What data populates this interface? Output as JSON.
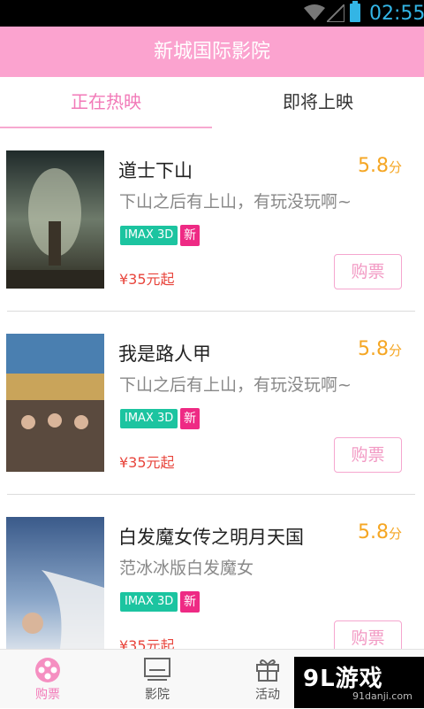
{
  "status_bar": {
    "time": "02:55",
    "accent_color": "#33b5e5",
    "icons": [
      "wifi-icon",
      "signal-icon",
      "battery-icon"
    ]
  },
  "header": {
    "title": "新城国际影院",
    "background_color": "#fba3cf"
  },
  "tabs": [
    {
      "label": "正在热映",
      "active": true
    },
    {
      "label": "即将上映",
      "active": false
    }
  ],
  "movies": [
    {
      "title": "道士下山",
      "rating": "5.8",
      "rating_unit": "分",
      "description": "下山之后有上山，有玩没玩啊~",
      "tag_format": "IMAX 3D",
      "tag_new": "新",
      "price": "¥35元起",
      "buy_label": "购票"
    },
    {
      "title": "我是路人甲",
      "rating": "5.8",
      "rating_unit": "分",
      "description": "下山之后有上山，有玩没玩啊~",
      "tag_format": "IMAX 3D",
      "tag_new": "新",
      "price": "¥35元起",
      "buy_label": "购票"
    },
    {
      "title": "白发魔女传之明月天国",
      "rating": "5.8",
      "rating_unit": "分",
      "description": "范冰冰版白发魔女",
      "tag_format": "IMAX 3D",
      "tag_new": "新",
      "price": "¥35元起",
      "buy_label": "购票"
    }
  ],
  "bottom_nav": [
    {
      "label": "购票",
      "icon": "film-reel-icon",
      "active": true
    },
    {
      "label": "影院",
      "icon": "screen-icon",
      "active": false
    },
    {
      "label": "活动",
      "icon": "gift-icon",
      "active": false
    }
  ],
  "watermark": {
    "main": "9L游戏",
    "url": "91danji.com"
  }
}
